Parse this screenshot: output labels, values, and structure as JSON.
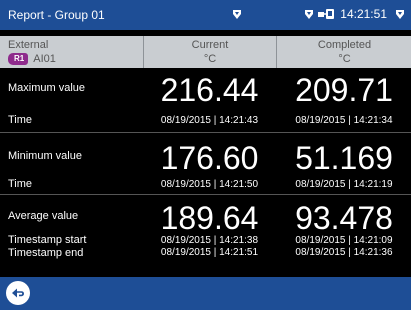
{
  "titlebar": {
    "title": "Report - Group 01",
    "time": "14:21:51",
    "icons": [
      "drop-down-icon",
      "connection-icon",
      "drop-down-icon"
    ]
  },
  "header": {
    "col1": {
      "line1": "External",
      "badge": "R1",
      "channel": "AI01"
    },
    "col2": {
      "line1": "Current",
      "line2": "°C"
    },
    "col3": {
      "line1": "Completed",
      "line2": "°C"
    }
  },
  "rows": {
    "max": {
      "label": "Maximum value",
      "current": "216.44",
      "completed": "209.71",
      "time_label": "Time",
      "current_time": "08/19/2015 | 14:21:43",
      "completed_time": "08/19/2015 | 14:21:34"
    },
    "min": {
      "label": "Minimum value",
      "current": "176.60",
      "completed": "51.169",
      "time_label": "Time",
      "current_time": "08/19/2015 | 14:21:50",
      "completed_time": "08/19/2015 | 14:21:19"
    },
    "avg": {
      "label": "Average value",
      "current": "189.64",
      "completed": "93.478",
      "start_label": "Timestamp start",
      "end_label": "Timestamp end",
      "current_start": "08/19/2015 | 14:21:38",
      "current_end": "08/19/2015 | 14:21:51",
      "completed_start": "08/19/2015 | 14:21:09",
      "completed_end": "08/19/2015 | 14:21:36"
    }
  },
  "bottombar": {
    "back_icon": "back-arrow-icon"
  },
  "colors": {
    "bar_blue": "#1e4e96",
    "header_gray": "#c9cdd1",
    "badge_purple": "#8e2a8c"
  }
}
